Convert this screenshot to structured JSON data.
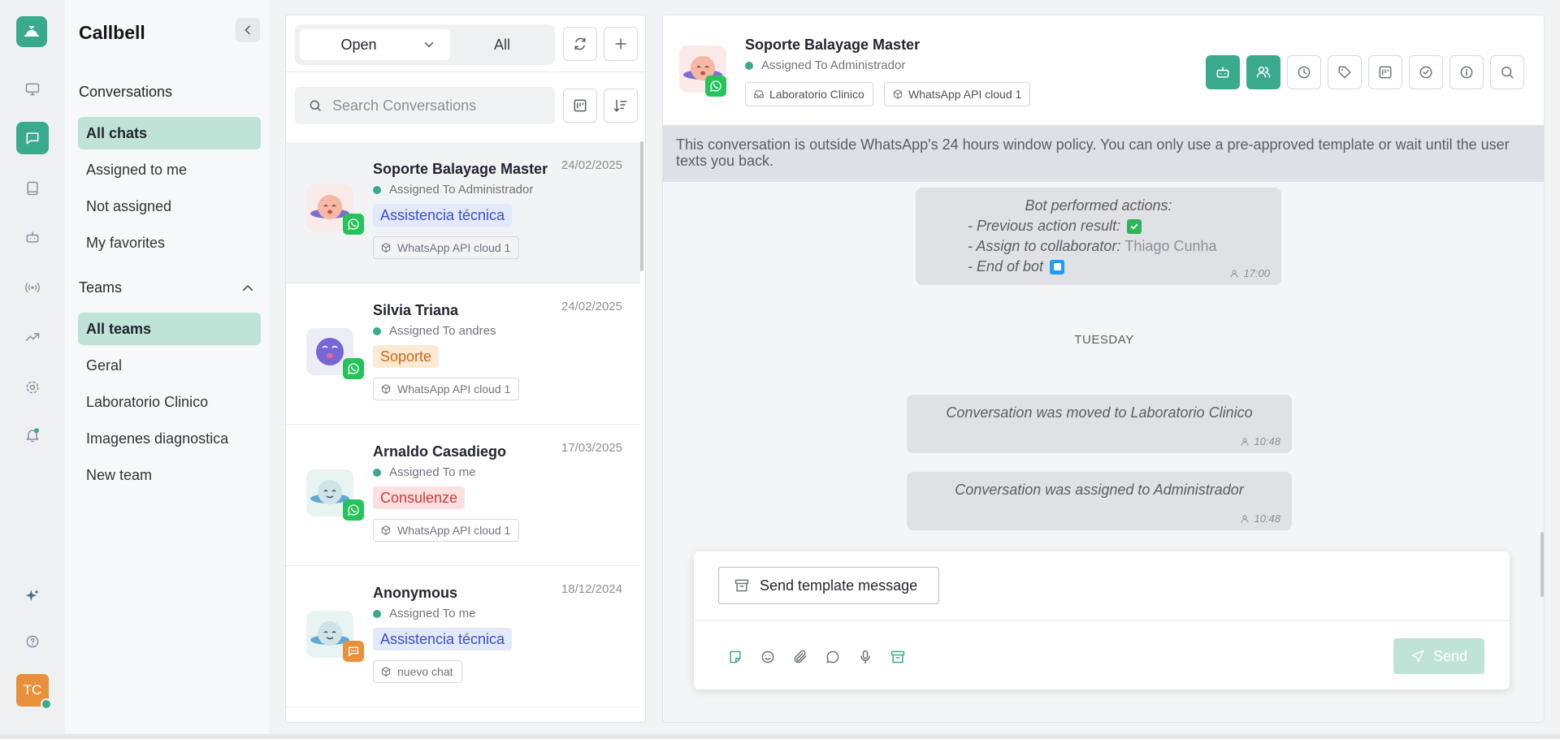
{
  "app": {
    "brand": "Callbell",
    "user_initials": "TC"
  },
  "sidebar": {
    "conversations_title": "Conversations",
    "items": [
      {
        "label": "All chats"
      },
      {
        "label": "Assigned to me"
      },
      {
        "label": "Not assigned"
      },
      {
        "label": "My favorites"
      }
    ],
    "teams_title": "Teams",
    "teams": [
      {
        "label": "All teams"
      },
      {
        "label": "Geral"
      },
      {
        "label": "Laboratorio Clinico"
      },
      {
        "label": "Imagenes diagnostica"
      },
      {
        "label": "New team"
      }
    ]
  },
  "list": {
    "filter_open": "Open",
    "filter_all": "All",
    "search_placeholder": "Search Conversations",
    "conversations": [
      {
        "name": "Soporte Balayage Master",
        "date": "24/02/2025",
        "assigned": "Assigned To Administrador",
        "tag": "Assistencia técnica",
        "channel": "WhatsApp API cloud 1"
      },
      {
        "name": "Silvia Triana",
        "date": "24/02/2025",
        "assigned": "Assigned To andres",
        "tag": "Soporte",
        "channel": "WhatsApp API cloud 1"
      },
      {
        "name": "Arnaldo Casadiego",
        "date": "17/03/2025",
        "assigned": "Assigned To me",
        "tag": "Consulenze",
        "channel": "WhatsApp API cloud 1"
      },
      {
        "name": "Anonymous",
        "date": "18/12/2024",
        "assigned": "Assigned To me",
        "tag": "Assistencia técnica",
        "channel": "nuevo chat"
      }
    ]
  },
  "chat": {
    "name": "Soporte Balayage Master",
    "assigned": "Assigned To Administrador",
    "team_chip": "Laboratorio Clinico",
    "channel_chip": "WhatsApp API cloud 1",
    "policy_notice": "This conversation is outside WhatsApp's 24 hours window policy. You can only use a pre-approved template or wait until the user texts you back.",
    "bot": {
      "title": "Bot performed actions:",
      "line1": "- Previous action result:",
      "line2": "- Assign to collaborator:",
      "collaborator": "Thiago Cunha",
      "line3": "- End of bot",
      "time": "17:00"
    },
    "day_separator": "TUESDAY",
    "system_messages": [
      {
        "text": "Conversation was moved to Laboratorio Clinico",
        "time": "10:48"
      },
      {
        "text": "Conversation was assigned to Administrador",
        "time": "10:48"
      }
    ],
    "template_button": "Send template message",
    "send_button": "Send"
  },
  "colors": {
    "accent": "#3aaa8c",
    "whatsapp": "#25c35a",
    "selected_nav": "#bfe3d6"
  }
}
